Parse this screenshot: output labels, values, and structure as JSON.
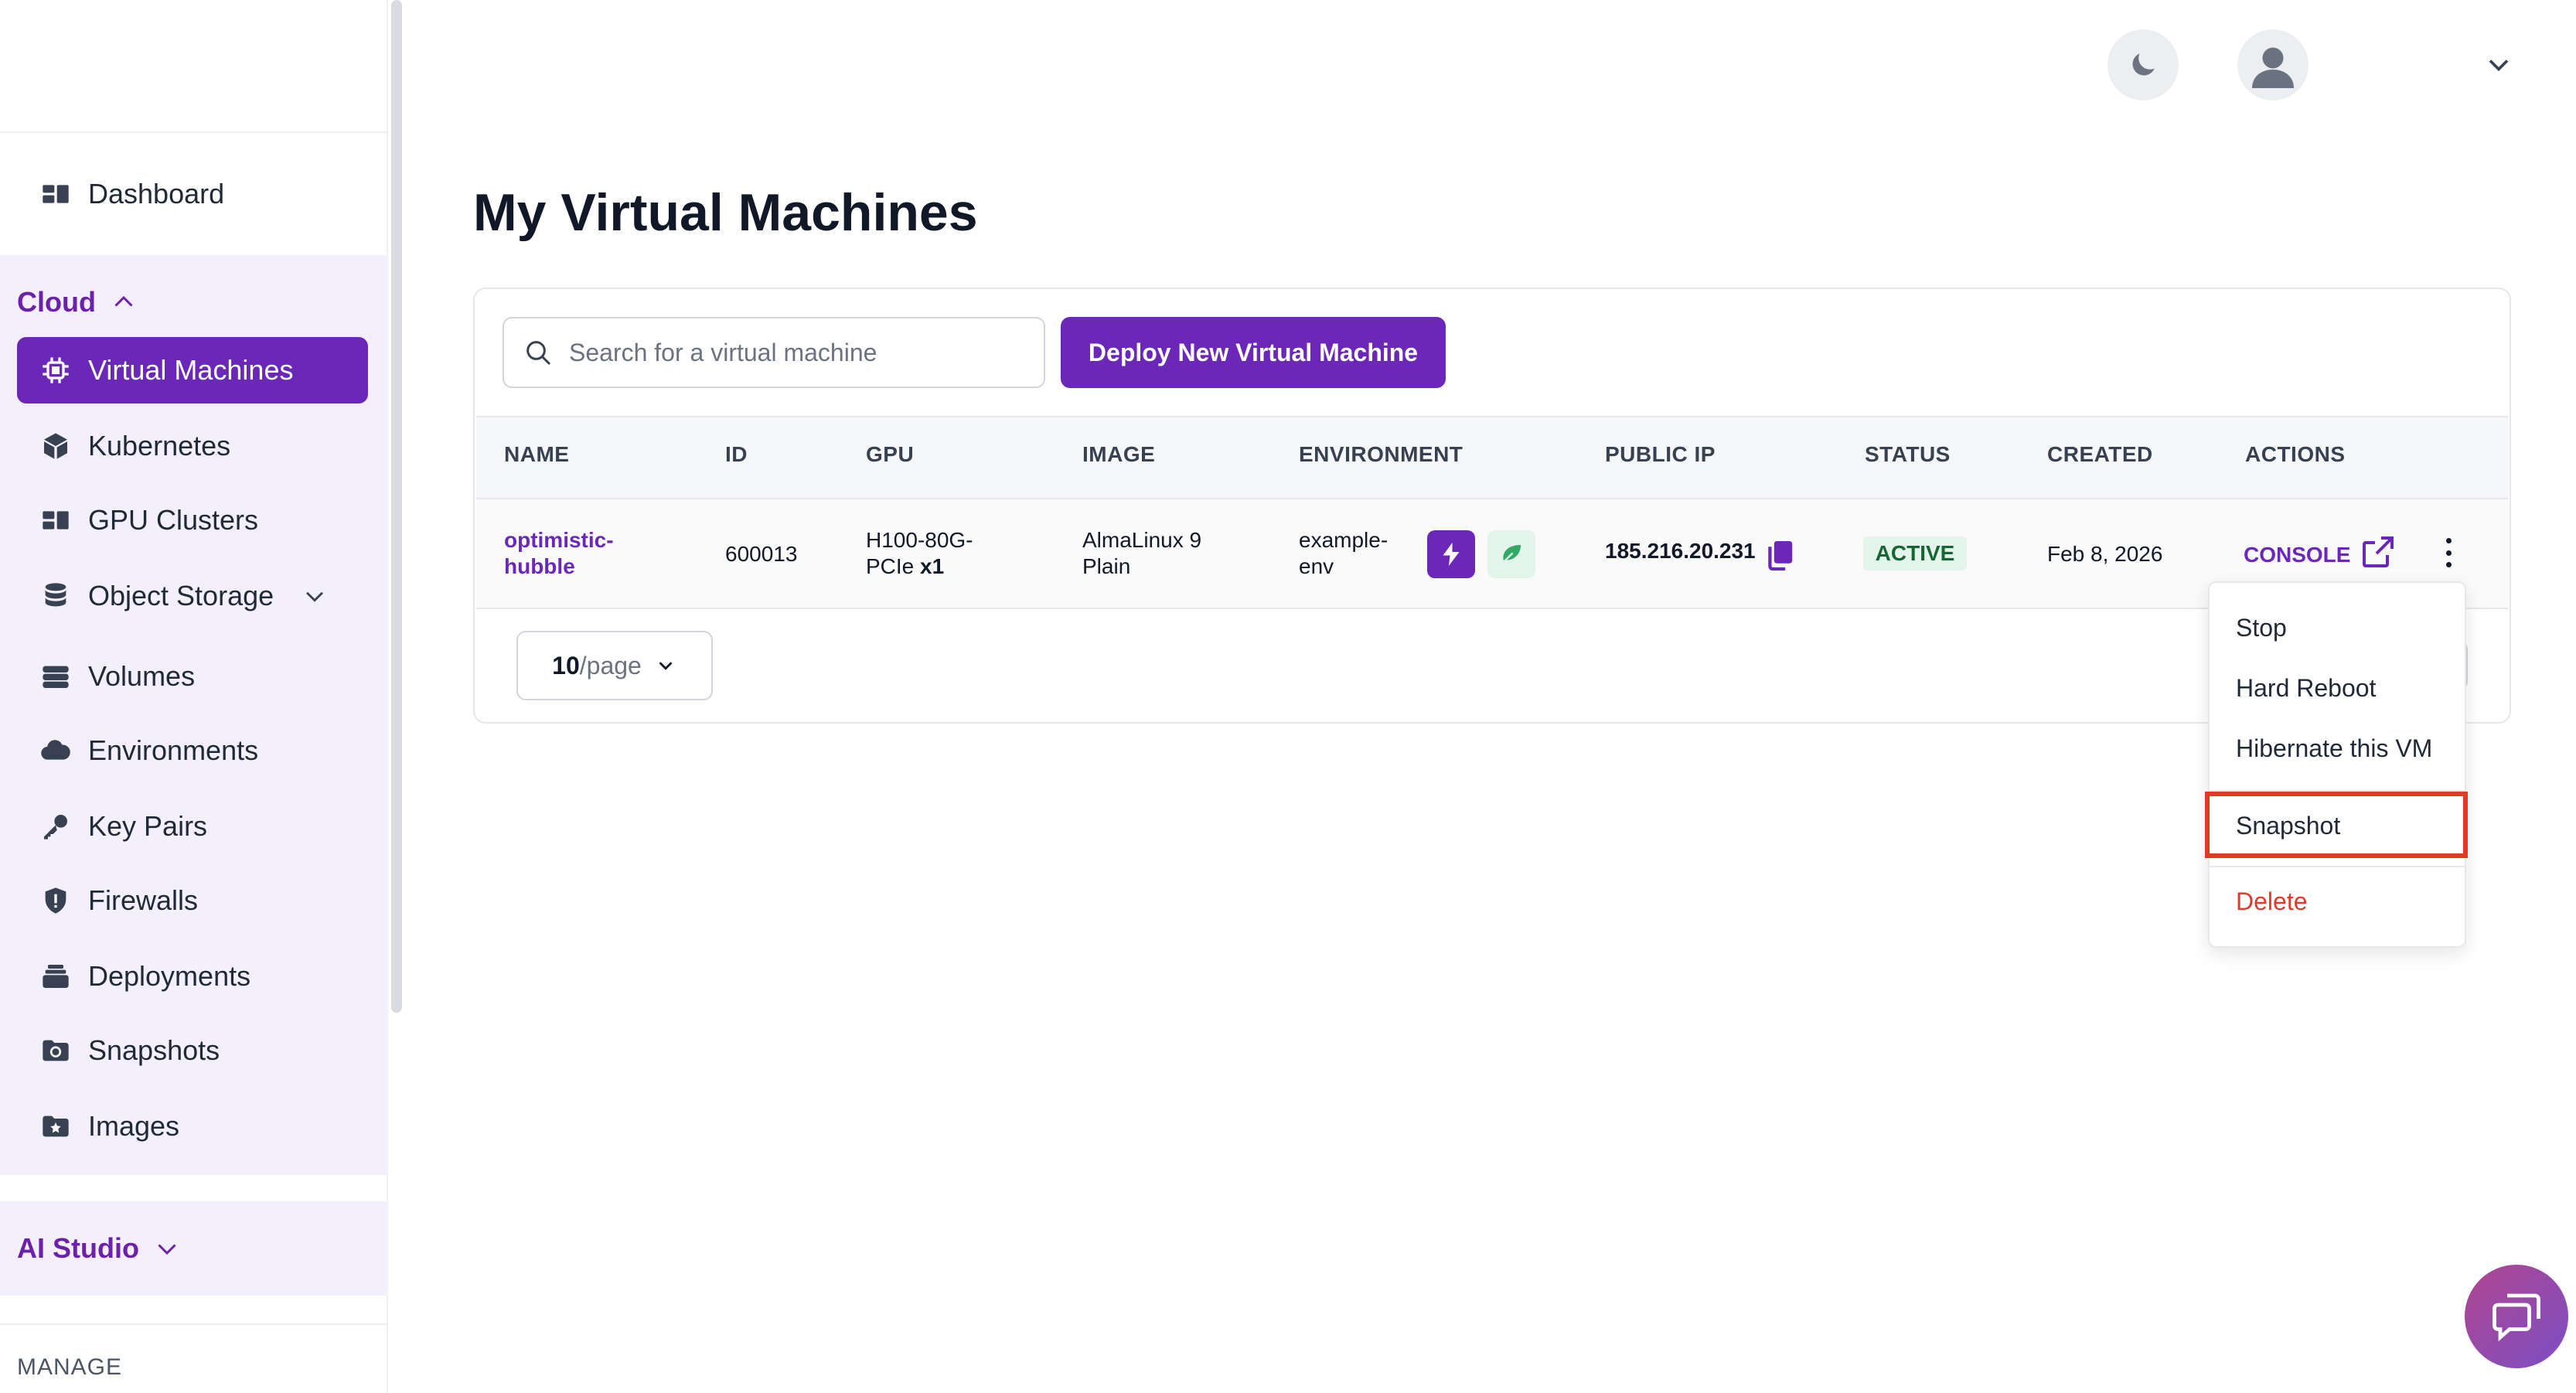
{
  "sidebar": {
    "dashboard": "Dashboard",
    "cloud_section": "Cloud",
    "items": [
      {
        "label": "Virtual Machines",
        "icon": "chip-icon",
        "active": true
      },
      {
        "label": "Kubernetes",
        "icon": "cube-icon"
      },
      {
        "label": "GPU Clusters",
        "icon": "grid-icon"
      },
      {
        "label": "Object Storage",
        "icon": "database-icon",
        "expandable": true
      },
      {
        "label": "Volumes",
        "icon": "server-icon"
      },
      {
        "label": "Environments",
        "icon": "cloud-icon"
      },
      {
        "label": "Key Pairs",
        "icon": "key-icon"
      },
      {
        "label": "Firewalls",
        "icon": "shield-icon"
      },
      {
        "label": "Deployments",
        "icon": "layers-icon"
      },
      {
        "label": "Snapshots",
        "icon": "snapshot-icon"
      },
      {
        "label": "Images",
        "icon": "image-folder-icon"
      }
    ],
    "ai_section": "AI Studio",
    "manage_label": "MANAGE"
  },
  "header": {
    "theme_icon": "moon-icon",
    "avatar_icon": "user-icon"
  },
  "main": {
    "title": "My Virtual Machines",
    "search_placeholder": "Search for a virtual machine",
    "deploy_label": "Deploy New Virtual Machine",
    "columns": [
      "NAME",
      "ID",
      "GPU",
      "IMAGE",
      "ENVIRONMENT",
      "PUBLIC IP",
      "STATUS",
      "CREATED",
      "ACTIONS"
    ],
    "rows": [
      {
        "name_line1": "optimistic-",
        "name_line2": "hubble",
        "id": "600013",
        "gpu_line1": "H100-80G-",
        "gpu_line2": "PCIe",
        "gpu_count": "x1",
        "image_line1": "AlmaLinux 9",
        "image_line2": "Plain",
        "env_line1": "example-",
        "env_line2": "env",
        "public_ip": "185.216.20.231",
        "status": "ACTIVE",
        "created": "Feb 8, 2026",
        "console": "CONSOLE"
      }
    ],
    "page_size_value": "10",
    "page_size_unit": "/page"
  },
  "menu": {
    "items": [
      "Stop",
      "Hard Reboot",
      "Hibernate this VM",
      "Snapshot",
      "Delete"
    ]
  },
  "colors": {
    "accent": "#6b28b8",
    "highlight": "#e03a24",
    "active_badge": "#e3f5ea",
    "delete": "#dc3b2e"
  }
}
